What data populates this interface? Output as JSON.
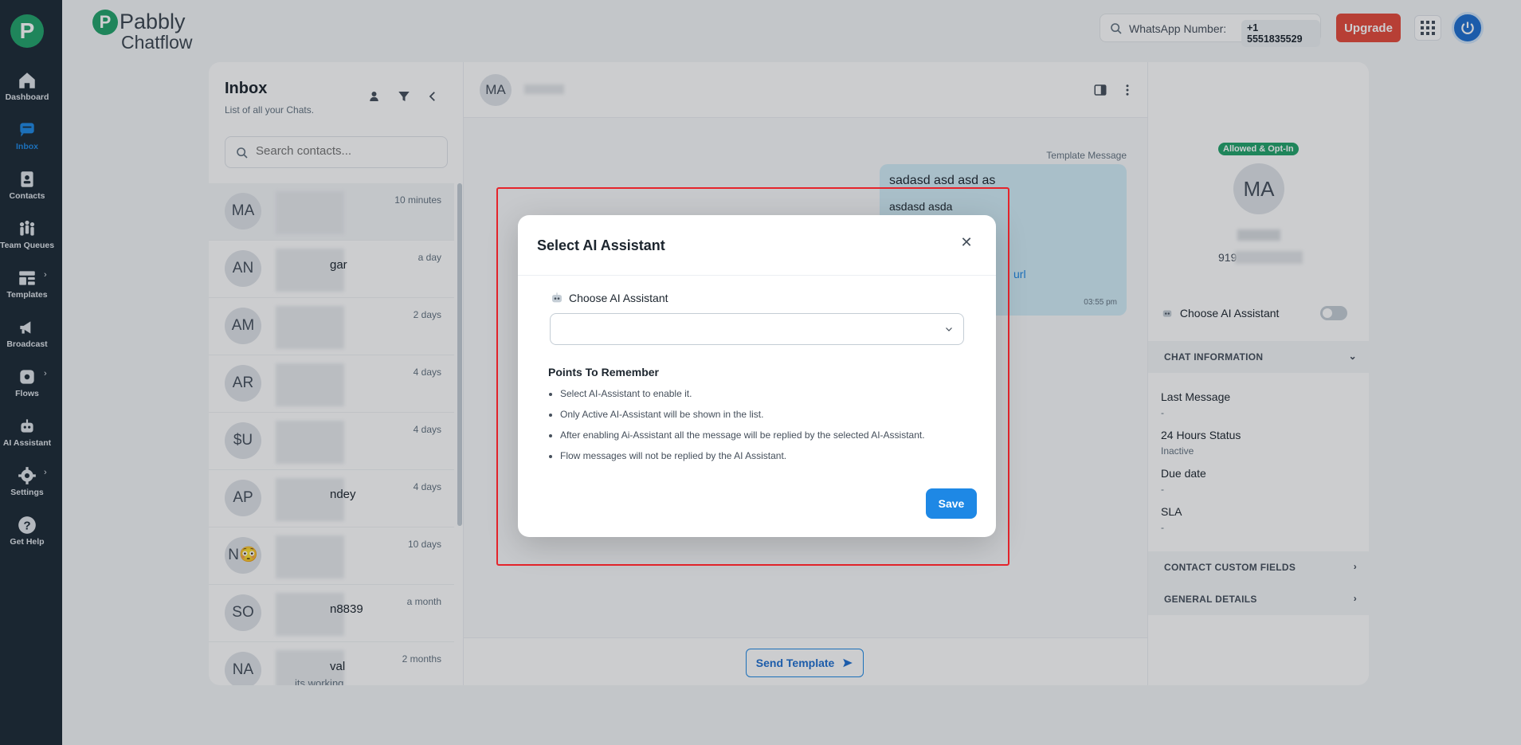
{
  "colors": {
    "accent": "#1e88e5",
    "brand": "#22a36b",
    "danger": "#e5493a",
    "sidebar": "#1c2a35",
    "highlight": "#e5242b"
  },
  "brand": {
    "logo_letter": "P",
    "name_top": "Pabbly",
    "name_bottom": "Chatflow"
  },
  "sidebar": {
    "items": [
      {
        "label": "Dashboard",
        "icon": "home-icon"
      },
      {
        "label": "Inbox",
        "icon": "chat-icon"
      },
      {
        "label": "Contacts",
        "icon": "contacts-icon"
      },
      {
        "label": "Team Queues",
        "icon": "team-icon"
      },
      {
        "label": "Templates",
        "icon": "template-icon"
      },
      {
        "label": "Broadcast",
        "icon": "megaphone-icon"
      },
      {
        "label": "Flows",
        "icon": "flow-icon"
      },
      {
        "label": "AI Assistant",
        "icon": "robot-icon"
      },
      {
        "label": "Settings",
        "icon": "gear-icon"
      },
      {
        "label": "Get Help",
        "icon": "help-icon"
      }
    ],
    "chevron": "›"
  },
  "header": {
    "whatsapp_label": "WhatsApp Number:",
    "whatsapp_number": "+1 5551835529",
    "upgrade_label": "Upgrade"
  },
  "inbox": {
    "title": "Inbox",
    "subtitle": "List of all your Chats.",
    "search_placeholder": "Search contacts...",
    "contacts": [
      {
        "initials": "MA",
        "name": "",
        "time": "10 minutes"
      },
      {
        "initials": "AN",
        "name": "gar",
        "time": "a day"
      },
      {
        "initials": "AM",
        "name": "",
        "time": "2 days"
      },
      {
        "initials": "AR",
        "name": "",
        "time": "4 days"
      },
      {
        "initials": "$U",
        "name": "",
        "time": "4 days"
      },
      {
        "initials": "AP",
        "name": "ndey",
        "time": "4 days"
      },
      {
        "initials": "N😳",
        "name": "",
        "time": "10 days"
      },
      {
        "initials": "SO",
        "name": "n8839",
        "time": "a month"
      },
      {
        "initials": "NA",
        "name": "val",
        "time": "2 months",
        "preview": "its working"
      }
    ]
  },
  "chat": {
    "contact_initials": "MA",
    "template_label": "Template Message",
    "bubble_line1": "sadasd asd asd as",
    "bubble_line2": "asdasd asda",
    "bubble_url": "url",
    "bubble_time": "03:55 pm",
    "send_template_label": "Send Template"
  },
  "right_panel": {
    "optin_badge": "Allowed & Opt-In",
    "initials": "MA",
    "phone_prefix": "919",
    "ai_label": "Choose AI Assistant",
    "chat_info_title": "CHAT INFORMATION",
    "fields": [
      {
        "key": "Last Message",
        "value": "-"
      },
      {
        "key": "24 Hours Status",
        "value": "Inactive"
      },
      {
        "key": "Due date",
        "value": "-"
      },
      {
        "key": "SLA",
        "value": "-"
      }
    ],
    "contact_custom_fields": "CONTACT CUSTOM FIELDS",
    "general_details": "GENERAL DETAILS"
  },
  "modal": {
    "title": "Select AI Assistant",
    "close_glyph": "✕",
    "field_label": "Choose AI Assistant",
    "selected_value": "",
    "points_title": "Points To Remember",
    "points": [
      "Select AI-Assistant to enable it.",
      "Only Active AI-Assistant will be shown in the list.",
      "After enabling Ai-Assistant all the message will be replied by the selected AI-Assistant.",
      "Flow messages will not be replied by the AI Assistant."
    ],
    "save_label": "Save"
  }
}
